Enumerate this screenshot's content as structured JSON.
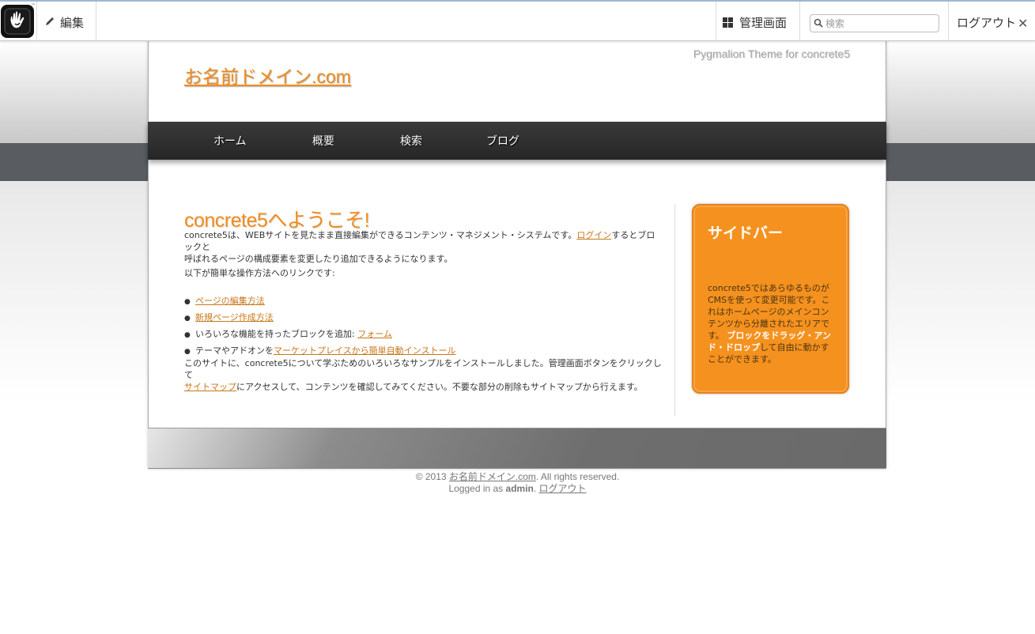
{
  "toolbar": {
    "edit_label": "編集",
    "dashboard_label": "管理画面",
    "search_placeholder": "検索",
    "logout_label": "ログアウト",
    "close_glyph": "✕"
  },
  "header": {
    "site_name": "お名前ドメイン.com",
    "theme_tagline": "Pygmalion Theme for concrete5"
  },
  "nav": {
    "items": [
      "ホーム",
      "概要",
      "検索",
      "ブログ"
    ]
  },
  "main": {
    "title": "concrete5へようこそ!",
    "intro_before": "concrete5は、WEBサイトを見たまま直接編集ができるコンテンツ・マネジメント・システムです。",
    "intro_link": "ログイン",
    "intro_after_1": "するとブロックと",
    "intro_after_2": "呼ばれるページの構成要素を変更したり追加できるようになります。",
    "links_heading": "以下が簡単な操作方法へのリンクです:",
    "list": {
      "item1_link": "ページの編集方法",
      "item2_link": "新規ページ作成方法",
      "item3_text": "いろいろな機能を持ったブロックを追加: ",
      "item3_link": "フォーム",
      "item4_text": "テーマやアドオンを",
      "item4_link": "マーケットプレイスから簡単自動インストール"
    },
    "closing_1": "このサイトに、concrete5について学ぶためのいろいろなサンプルをインストールしました。管理画面ボタンをクリックして",
    "closing_link": "サイトマップ",
    "closing_2": "にアクセスして、コンテンツを確認してみてください。不要な部分の削除もサイトマップから行えます。"
  },
  "sidebar": {
    "title": "サイドバー",
    "text_before": "concrete5ではあらゆるものがCMSを使って変更可能です。これはホームページのメインコンテンツから分離されたエリアです。",
    "text_bold": "ブロックをドラッグ・アンド・ドロップ",
    "text_after": "して自由に動かすことができます。"
  },
  "footer": {
    "copyright_prefix": "© 2013 ",
    "copyright_link": "お名前ドメイン.com",
    "copyright_suffix": ". All rights reserved.",
    "logged_in_prefix": "Logged in as ",
    "user": "admin",
    "logged_in_sep": ". ",
    "logout_link": "ログアウト"
  },
  "colors": {
    "accent": "#f28c1c",
    "sidebar_bg": "#f5911f",
    "nav_bg": "#2c2c2c",
    "band": "#595d61"
  },
  "icons": [
    "concrete5-hand-logo",
    "pencil-icon",
    "dashboard-grid-icon",
    "search-icon",
    "close-icon"
  ]
}
